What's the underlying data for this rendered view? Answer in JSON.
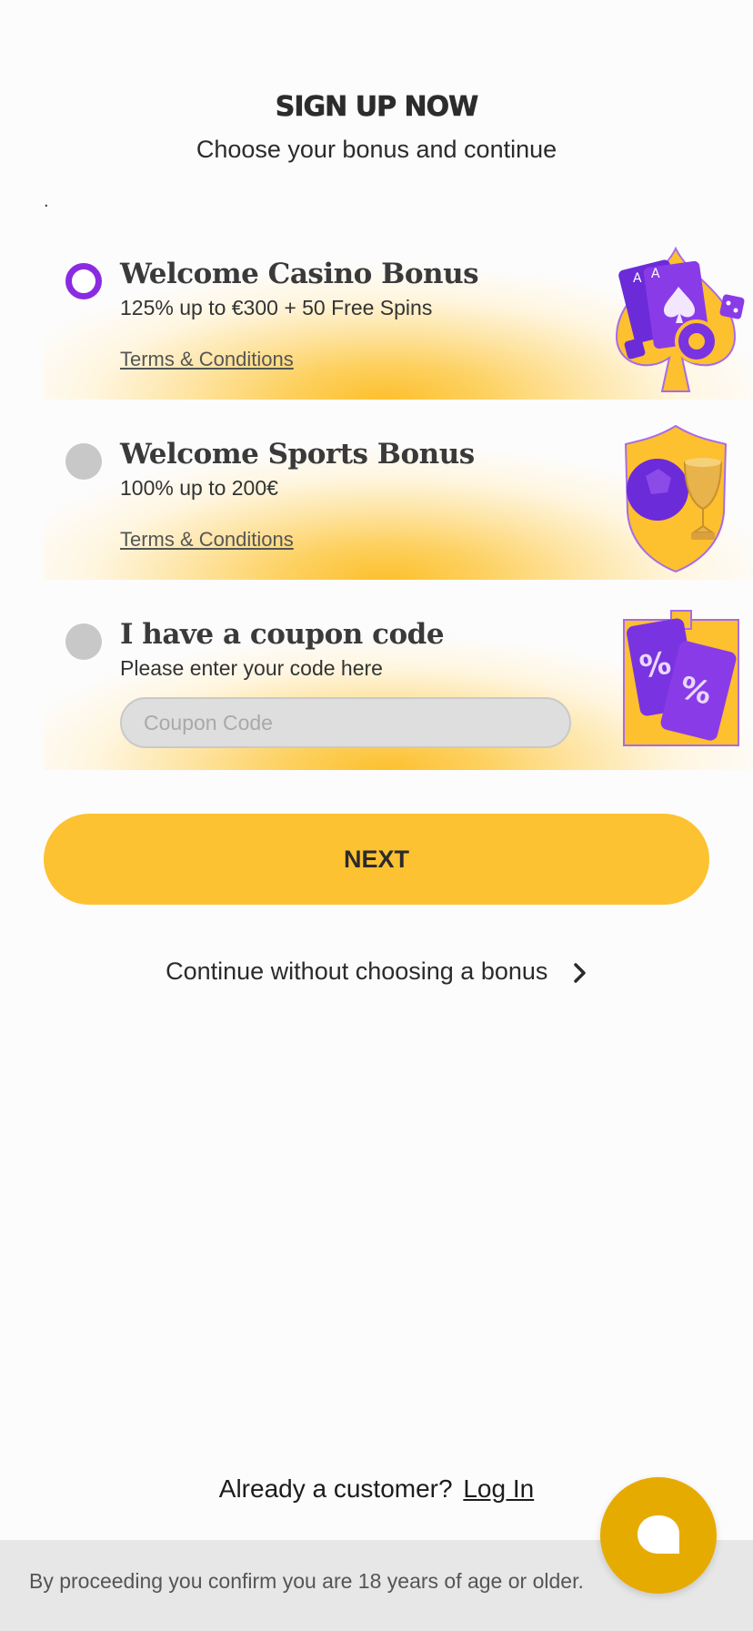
{
  "header": {
    "title": "SIGN UP NOW",
    "subtitle": "Choose your bonus and continue"
  },
  "stray_mark": ".",
  "bonuses": [
    {
      "title": "Welcome Casino Bonus",
      "description": "125% up to €300 + 50 Free Spins",
      "link": "Terms & Conditions",
      "selected": true,
      "icon": "casino-cards-chips-icon"
    },
    {
      "title": "Welcome Sports Bonus",
      "description": "100% up to 200€",
      "link": "Terms & Conditions",
      "selected": false,
      "icon": "sports-shield-trophy-icon"
    },
    {
      "title": "I have a coupon code",
      "description": "Please enter your code here",
      "input_placeholder": "Coupon Code",
      "input_value": "",
      "selected": false,
      "icon": "coupon-gift-icon"
    }
  ],
  "next_button": "NEXT",
  "continue_link": "Continue without choosing a bonus",
  "login_prompt": {
    "text": "Already a customer?",
    "link": "Log In"
  },
  "footer": "By proceeding you confirm you are 18 years of age or older.",
  "colors": {
    "accent_yellow": "#fdc232",
    "radio_selected": "#8a2be2",
    "chat_button": "#e6ab00"
  }
}
